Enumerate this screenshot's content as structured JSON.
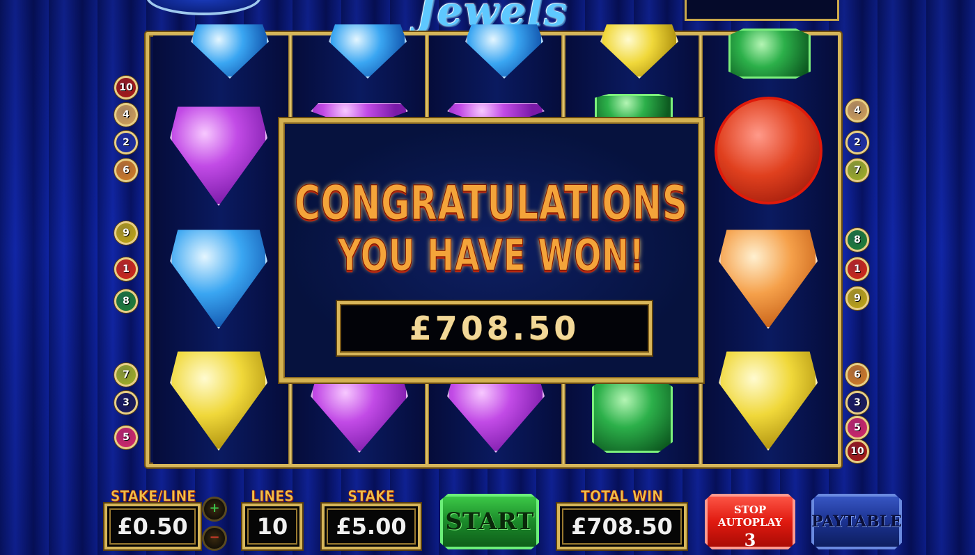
{
  "game": {
    "title": "Jewels"
  },
  "win_popup": {
    "line1": "CONGRATULATIONS",
    "line2": "YOU HAVE WON!",
    "amount": "£708.50"
  },
  "paylines": {
    "left": [
      "10",
      "4",
      "2",
      "6",
      "9",
      "1",
      "8",
      "7",
      "3",
      "5"
    ],
    "right": [
      "4",
      "2",
      "7",
      "8",
      "1",
      "9",
      "6",
      "3",
      "5",
      "10"
    ],
    "colors": {
      "1": "#c8281c",
      "2": "#1e2e9e",
      "3": "#1a1a5a",
      "4": "#c89a5a",
      "5": "#c8286a",
      "6": "#c8782a",
      "7": "#9aa82a",
      "8": "#1f7a3a",
      "9": "#b8a01a",
      "10": "#a01a1a"
    }
  },
  "reels": [
    [
      "blue-shield-icon",
      "purple-shield-icon",
      "blue-shield-icon",
      "yellow-shield-icon"
    ],
    [
      "blue-shield-icon",
      "purple-shield-icon",
      "",
      "purple-shield-icon"
    ],
    [
      "blue-shield-icon",
      "purple-shield-icon",
      "",
      "purple-shield-icon"
    ],
    [
      "yellow-shield-icon",
      "green-emerald-icon",
      "",
      "green-emerald-icon"
    ],
    [
      "green-emerald-icon",
      "red-round-icon",
      "orange-shield-icon",
      "yellow-shield-icon"
    ]
  ],
  "controls": {
    "stake_line_label": "STAKE/LINE",
    "stake_line_value": "£0.50",
    "lines_label": "LINES",
    "lines_value": "10",
    "stake_label": "STAKE",
    "stake_value": "£5.00",
    "start_label": "START",
    "total_win_label": "TOTAL WIN",
    "total_win_value": "£708.50",
    "stop_autoplay_label": "STOP AUTOPLAY",
    "autoplay_count": "3",
    "paytable_label": "PAYTABLE"
  }
}
